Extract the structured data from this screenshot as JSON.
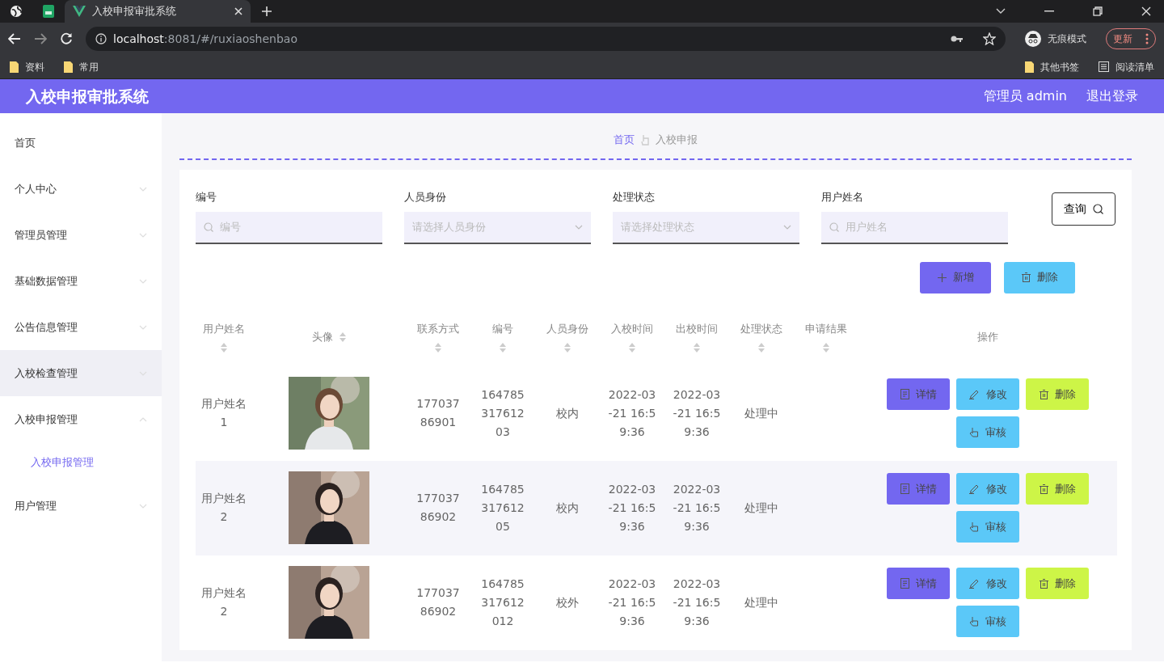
{
  "browser": {
    "tab_title": "入校申报审批系统",
    "url_host": "localhost",
    "url_path": ":8081/#/ruxiaoshenbao",
    "incognito_label": "无痕模式",
    "update_label": "更新",
    "bookmarks": [
      "资料",
      "常用"
    ],
    "other_bookmarks": "其他书签",
    "reading_list": "阅读清单"
  },
  "app": {
    "title": "入校申报审批系统",
    "user": "管理员 admin",
    "logout": "退出登录"
  },
  "sidebar": {
    "items": [
      {
        "label": "首页",
        "expandable": false,
        "expanded": false,
        "hovered": false
      },
      {
        "label": "个人中心",
        "expandable": true,
        "expanded": false,
        "hovered": false
      },
      {
        "label": "管理员管理",
        "expandable": true,
        "expanded": false,
        "hovered": false
      },
      {
        "label": "基础数据管理",
        "expandable": true,
        "expanded": false,
        "hovered": false
      },
      {
        "label": "公告信息管理",
        "expandable": true,
        "expanded": false,
        "hovered": false
      },
      {
        "label": "入校检查管理",
        "expandable": true,
        "expanded": false,
        "hovered": true
      },
      {
        "label": "入校申报管理",
        "expandable": true,
        "expanded": true,
        "hovered": false,
        "children": [
          {
            "label": "入校申报管理",
            "selected": true
          }
        ]
      },
      {
        "label": "用户管理",
        "expandable": true,
        "expanded": false,
        "hovered": false
      }
    ]
  },
  "breadcrumb": [
    "首页",
    "入校申报"
  ],
  "filters": [
    {
      "label": "编号",
      "kind": "text",
      "placeholder": "编号"
    },
    {
      "label": "人员身份",
      "kind": "select",
      "placeholder": "请选择人员身份"
    },
    {
      "label": "处理状态",
      "kind": "select",
      "placeholder": "请选择处理状态"
    },
    {
      "label": "用户姓名",
      "kind": "text",
      "placeholder": "用户姓名"
    }
  ],
  "search_button": "查询",
  "toolbar": [
    {
      "label": "新增",
      "kind": "add"
    },
    {
      "label": "删除",
      "kind": "delete"
    }
  ],
  "table": {
    "columns": [
      {
        "label": "用户姓名",
        "sortable": true
      },
      {
        "label": "头像",
        "sortable": true
      },
      {
        "label": "联系方式",
        "sortable": true
      },
      {
        "label": "编号",
        "sortable": true
      },
      {
        "label": "人员身份",
        "sortable": true
      },
      {
        "label": "入校时间",
        "sortable": true
      },
      {
        "label": "出校时间",
        "sortable": true
      },
      {
        "label": "处理状态",
        "sortable": true
      },
      {
        "label": "申请结果",
        "sortable": true
      },
      {
        "label": "操作",
        "sortable": false
      }
    ],
    "rows": [
      {
        "name": "用户姓名1",
        "contact": "17703786901",
        "number": "16478531761203",
        "identity": "校内",
        "entry_time": "2022-03-21 16:59:36",
        "exit_time": "2022-03-21 16:59:36",
        "status": "处理中",
        "actions": [
          {
            "label": "详情",
            "kind": "detail"
          },
          {
            "label": "修改",
            "kind": "edit"
          },
          {
            "label": "删除",
            "kind": "delete"
          },
          {
            "label": "审核",
            "kind": "review"
          }
        ]
      },
      {
        "name": "用户姓名2",
        "contact": "17703786902",
        "number": "16478531761205",
        "identity": "校内",
        "entry_time": "2022-03-21 16:59:36",
        "exit_time": "2022-03-21 16:59:36",
        "status": "处理中",
        "actions": [
          {
            "label": "详情",
            "kind": "detail"
          },
          {
            "label": "修改",
            "kind": "edit"
          },
          {
            "label": "删除",
            "kind": "delete"
          },
          {
            "label": "审核",
            "kind": "review"
          }
        ]
      },
      {
        "name": "用户姓名2",
        "contact": "17703786902",
        "number": "164785317612012",
        "identity": "校外",
        "entry_time": "2022-03-21 16:59:36",
        "exit_time": "2022-03-21 16:59:36",
        "status": "处理中",
        "actions": [
          {
            "label": "详情",
            "kind": "detail"
          },
          {
            "label": "修改",
            "kind": "edit"
          },
          {
            "label": "删除",
            "kind": "delete"
          },
          {
            "label": "审核",
            "kind": "review"
          }
        ]
      }
    ]
  }
}
